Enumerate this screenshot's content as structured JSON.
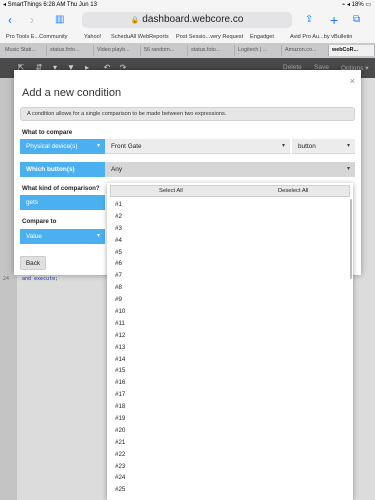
{
  "status_bar": {
    "left": "◂ SmartThings  6:28 AM   Thu Jun 13",
    "right": "⌁ ◂ 18% ▭"
  },
  "browser": {
    "url": "dashboard.webcore.co",
    "bookmarks": [
      "Pro Tools E...Community",
      "Yahoo!",
      "ScheduAll WebReports",
      "Post Sessio...very Request",
      "Engadget",
      "Avid Pro Au...by vBulletin"
    ],
    "tabs": [
      "Music Stati...",
      "status.foto...",
      "Video playb...",
      "56 random...",
      "status.foto...",
      "Logitech | ...",
      "Amazon.co...",
      "webCoR..."
    ]
  },
  "app_toolbar": {
    "delete": "Delete",
    "save": "Save",
    "options": "Options ▾"
  },
  "editor": {
    "line_number": "24",
    "code": "and execute;"
  },
  "modal": {
    "title": "Add a new condition",
    "close": "×",
    "info": "A condition allows for a single comparison to be made between two expressions.",
    "what_to_compare_label": "What to compare",
    "compare_type": "Physical device(s)",
    "device": "Front Gate",
    "attribute": "button",
    "which_button_label": "Which button(s)",
    "which_button_value": "Any",
    "comparison_label": "What kind of comparison?",
    "comparison_value": "gets",
    "compare_to_label": "Compare to",
    "compare_to_value": "Value",
    "back": "Back"
  },
  "dropdown": {
    "select_all": "Select All",
    "deselect_all": "Deselect All",
    "items": [
      "#1",
      "#2",
      "#3",
      "#4",
      "#5",
      "#6",
      "#7",
      "#8",
      "#9",
      "#10",
      "#11",
      "#12",
      "#13",
      "#14",
      "#15",
      "#16",
      "#17",
      "#18",
      "#19",
      "#20",
      "#21",
      "#22",
      "#23",
      "#24",
      "#25"
    ]
  }
}
